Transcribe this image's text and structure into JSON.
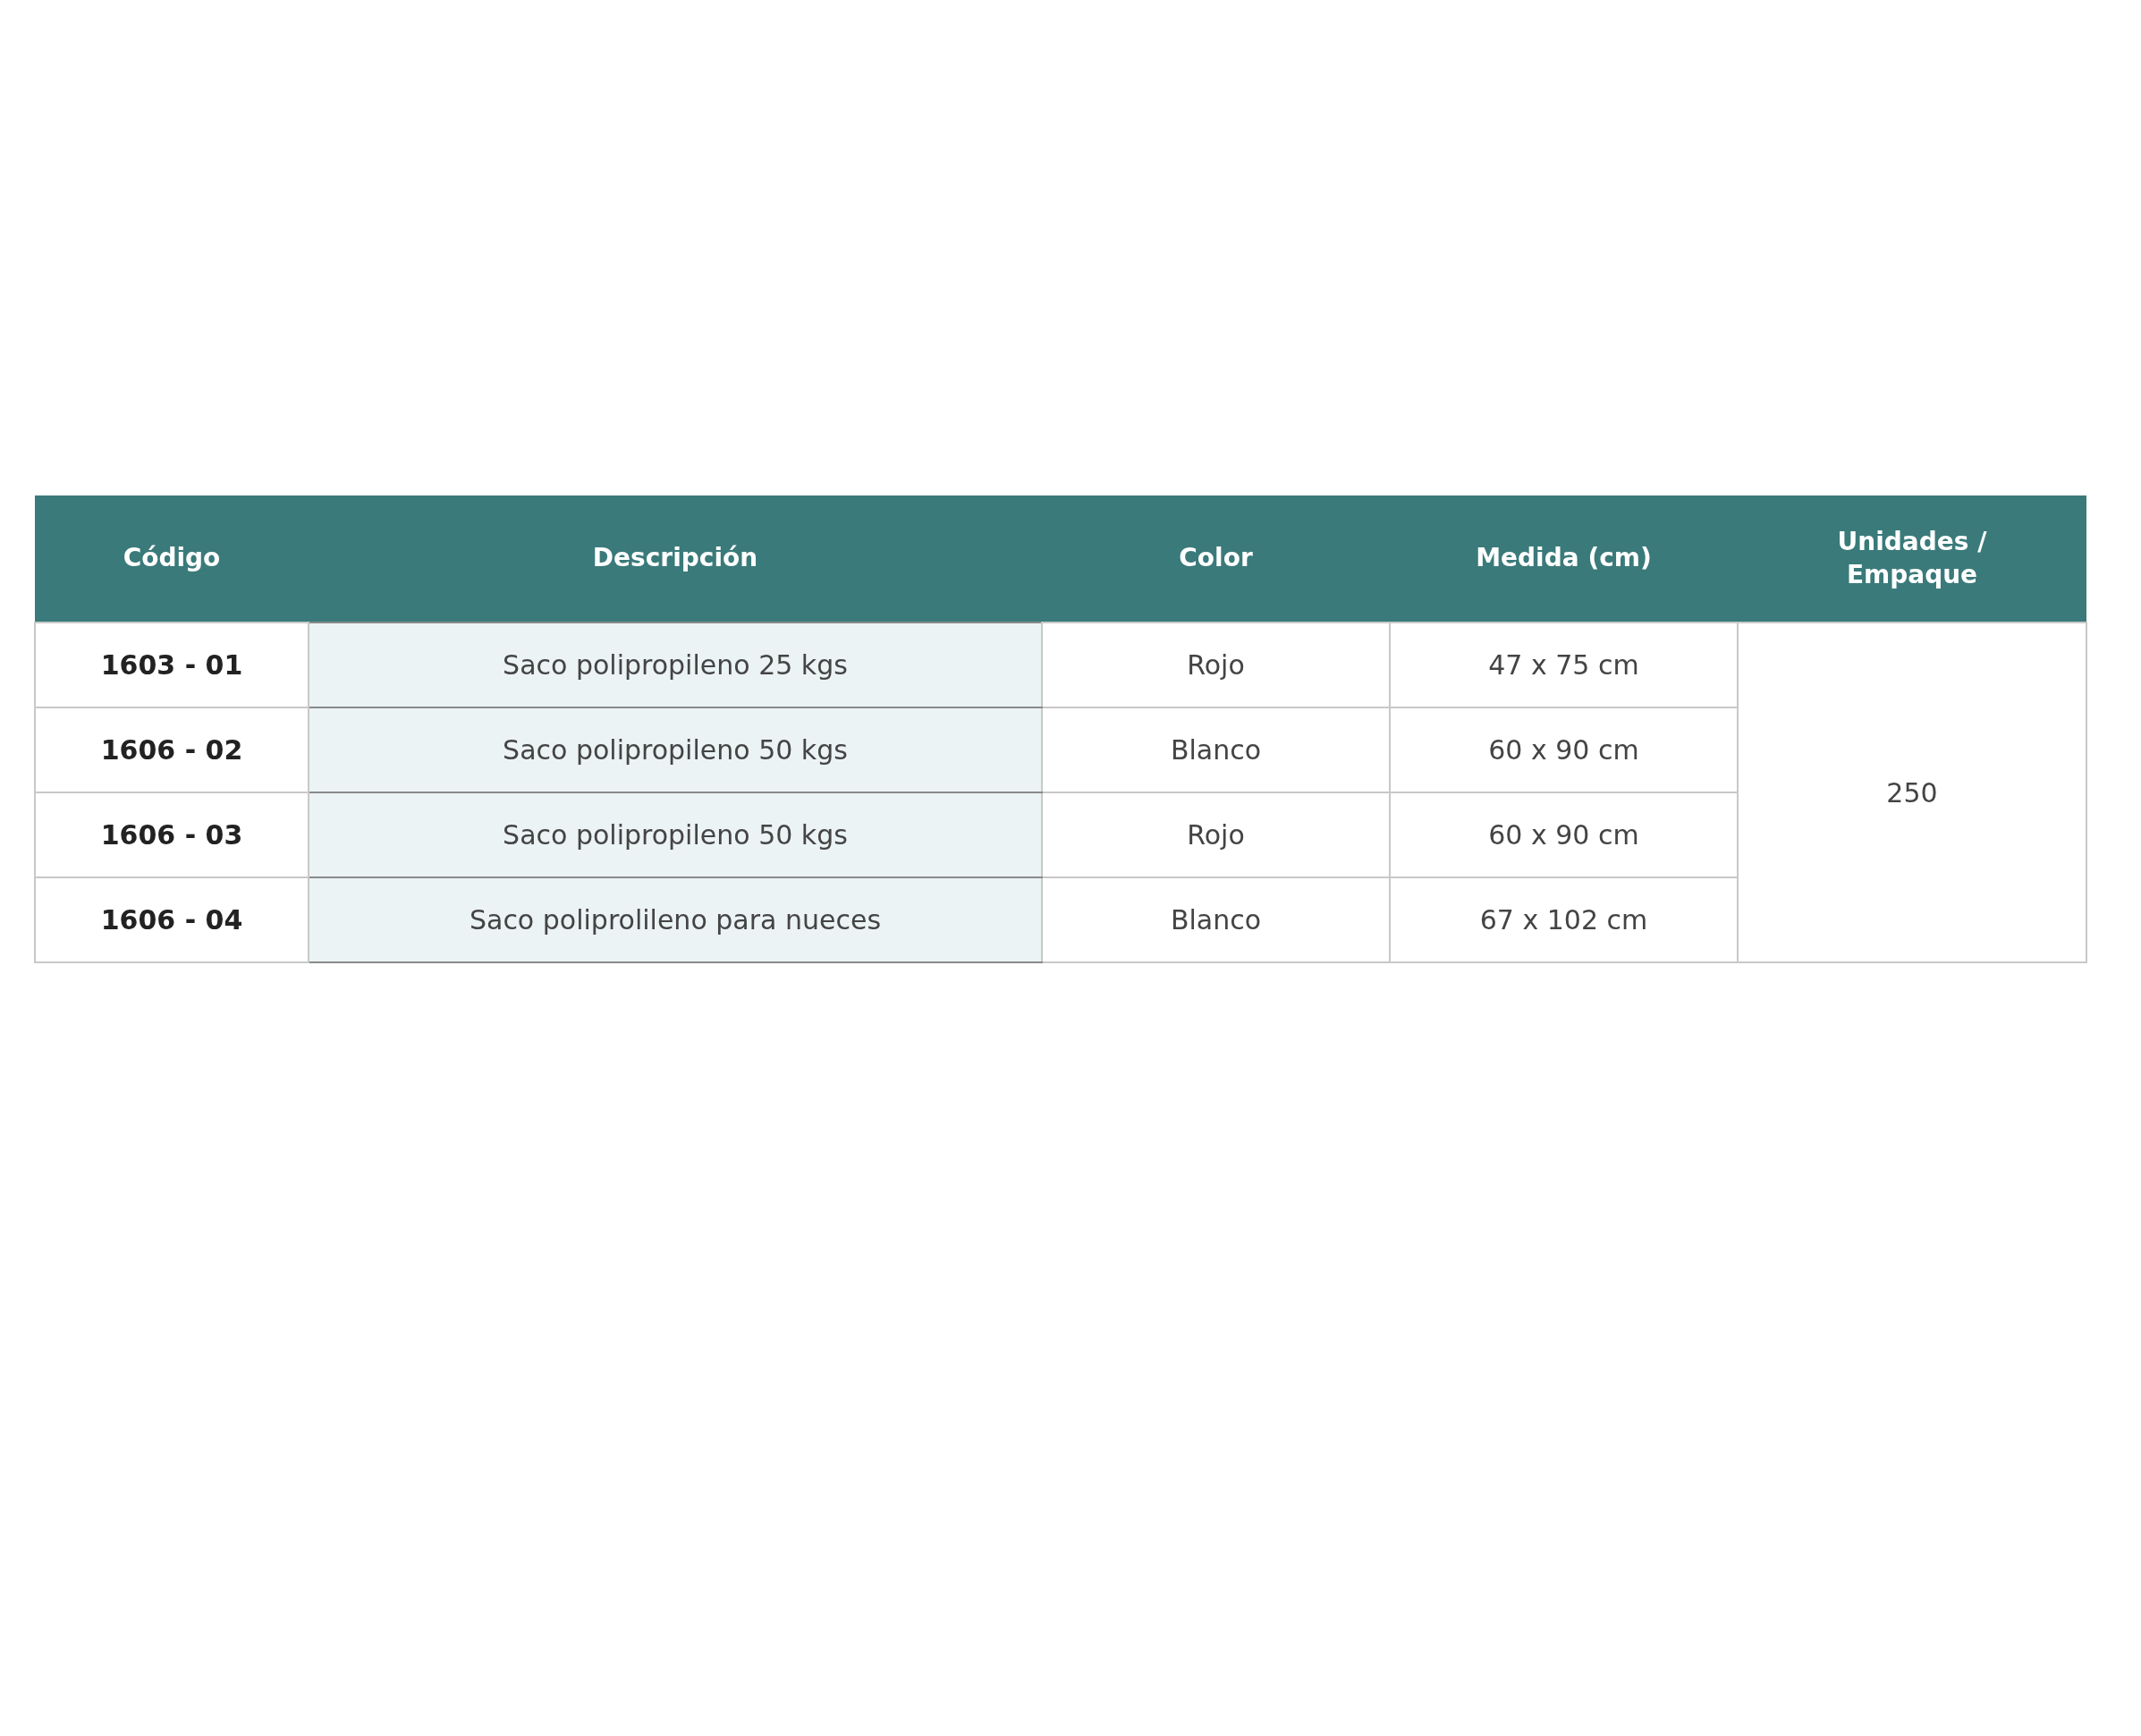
{
  "table": {
    "columns": [
      "Código",
      "Descripción",
      "Color",
      "Medida (cm)",
      "Unidades / Empaque"
    ],
    "rows": [
      {
        "code": "1603 - 01",
        "description": "Saco polipropileno 25 kgs",
        "colour_name": "Rojo",
        "size": "47 x 75 cm"
      },
      {
        "code": "1606 - 02",
        "description": "Saco polipropileno 50 kgs",
        "colour_name": "Blanco",
        "size": "60 x 90 cm"
      },
      {
        "code": "1606 - 03",
        "description": "Saco polipropileno 50 kgs",
        "colour_name": "Rojo",
        "size": "60 x 90 cm"
      },
      {
        "code": "1606 - 04",
        "description": "Saco poliprolileno para nueces",
        "colour_name": "Blanco",
        "size": "67 x 102 cm"
      }
    ],
    "units_per_pack": "250"
  }
}
